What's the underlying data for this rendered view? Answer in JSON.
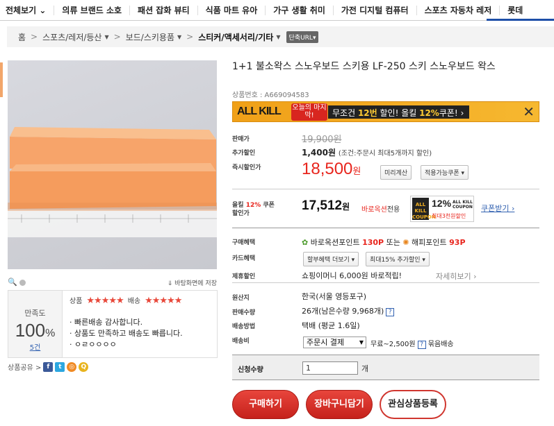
{
  "topnav": {
    "items": [
      "전체보기 ⌄",
      "의류 브랜드 소호",
      "패션 잡화 뷰티",
      "식품 마트 유아",
      "가구 생활 취미",
      "가전 디지털 컴퓨터",
      "스포츠 자동차 레저",
      "롯데"
    ]
  },
  "breadcrumb": {
    "home": "홈",
    "items": [
      "스포츠/레저/등산",
      "보드/스키용품",
      "스티커/액세서리/기타"
    ],
    "url_button": "단축URL"
  },
  "image_tools": {
    "save_label": "바탕화면에 저장"
  },
  "rating": {
    "label": "만족도",
    "percent": "100",
    "percent_sign": "%",
    "count": "5건",
    "product_label": "상품",
    "shipping_label": "배송",
    "stars": "★★★★★",
    "reviews": [
      "빠른배송 감사합니다.",
      "상품도 만족하고 배송도 빠릅니다.",
      "ㅇㄹㅇㅇㅇㅇ"
    ]
  },
  "share": {
    "label": "상품공유 >"
  },
  "product": {
    "title": "1+1 불소왁스 스노우보드 스키용 LF-250 스키 스노우보드 왁스",
    "code": "상품번호 : A669094583"
  },
  "banner": {
    "allkill": "ALL KILL",
    "tag": "오늘의 마지막!",
    "msg_pre": "무조건 ",
    "msg_12": "12번",
    "msg_mid": " 할인! 올킬 ",
    "msg_pct": "12%",
    "msg_post": "쿠폰!",
    "close": "✕"
  },
  "pricing": {
    "price_label": "판매가",
    "original_price": "19,900원",
    "add_discount_label": "추가할인",
    "add_discount_amount": "1,400원",
    "add_discount_note": "(조건:주문시 최대5개까지 할인)",
    "instant_label": "즉시할인가",
    "sale_price": "18,500",
    "sale_unit": "원",
    "preview_button": "미리계산",
    "coupon_button": "적용가능쿠폰 ▾"
  },
  "coupon": {
    "label_pre": "올킬 ",
    "label_pct": "12%",
    "label_post": " 쿠폰",
    "label_line2": "할인가",
    "price": "17,512",
    "unit": "원",
    "shop": "바로옥션",
    "shop_suffix": "전용",
    "badge_brand": "ALL KILL COUPON",
    "badge_pct": "12%",
    "badge_small": "ALL KILL COUPON",
    "badge_max": "최대3천원할인",
    "get_link": "쿠폰받기 ›"
  },
  "benefits": {
    "buy_label": "구매혜택",
    "buy_text_1": "바로옥션포인트 ",
    "buy_point_1": "130P",
    "buy_text_2": " 또는 ",
    "buy_text_3": "해피포인트 ",
    "buy_point_2": "93P",
    "card_label": "카드혜택",
    "card_btn_1": "할부혜택 더보기 ▾",
    "card_btn_2": "최대15% 추가할인 ▾",
    "partner_label": "제휴할인",
    "partner_text": "쇼핑이머니 6,000원 바로적립!",
    "partner_more": "자세히보기 ›"
  },
  "info": {
    "origin_label": "원산지",
    "origin": "한국(서울 영등포구)",
    "sales_label": "판매수량",
    "sales": "26개(남은수량 9,968개)",
    "ship_method_label": "배송방법",
    "ship_method": "택배 (평균 1.6일)",
    "ship_fee_label": "배송비",
    "ship_fee_select": "주문시 결제",
    "ship_fee_text": "무료~2,500원",
    "ship_fee_bundle": "묶음배송",
    "help": "?"
  },
  "quantity": {
    "label": "신청수량",
    "value": "1",
    "unit": "개"
  },
  "actions": {
    "buy": "구매하기",
    "cart": "장바구니담기",
    "wish": "관심상품등록"
  }
}
